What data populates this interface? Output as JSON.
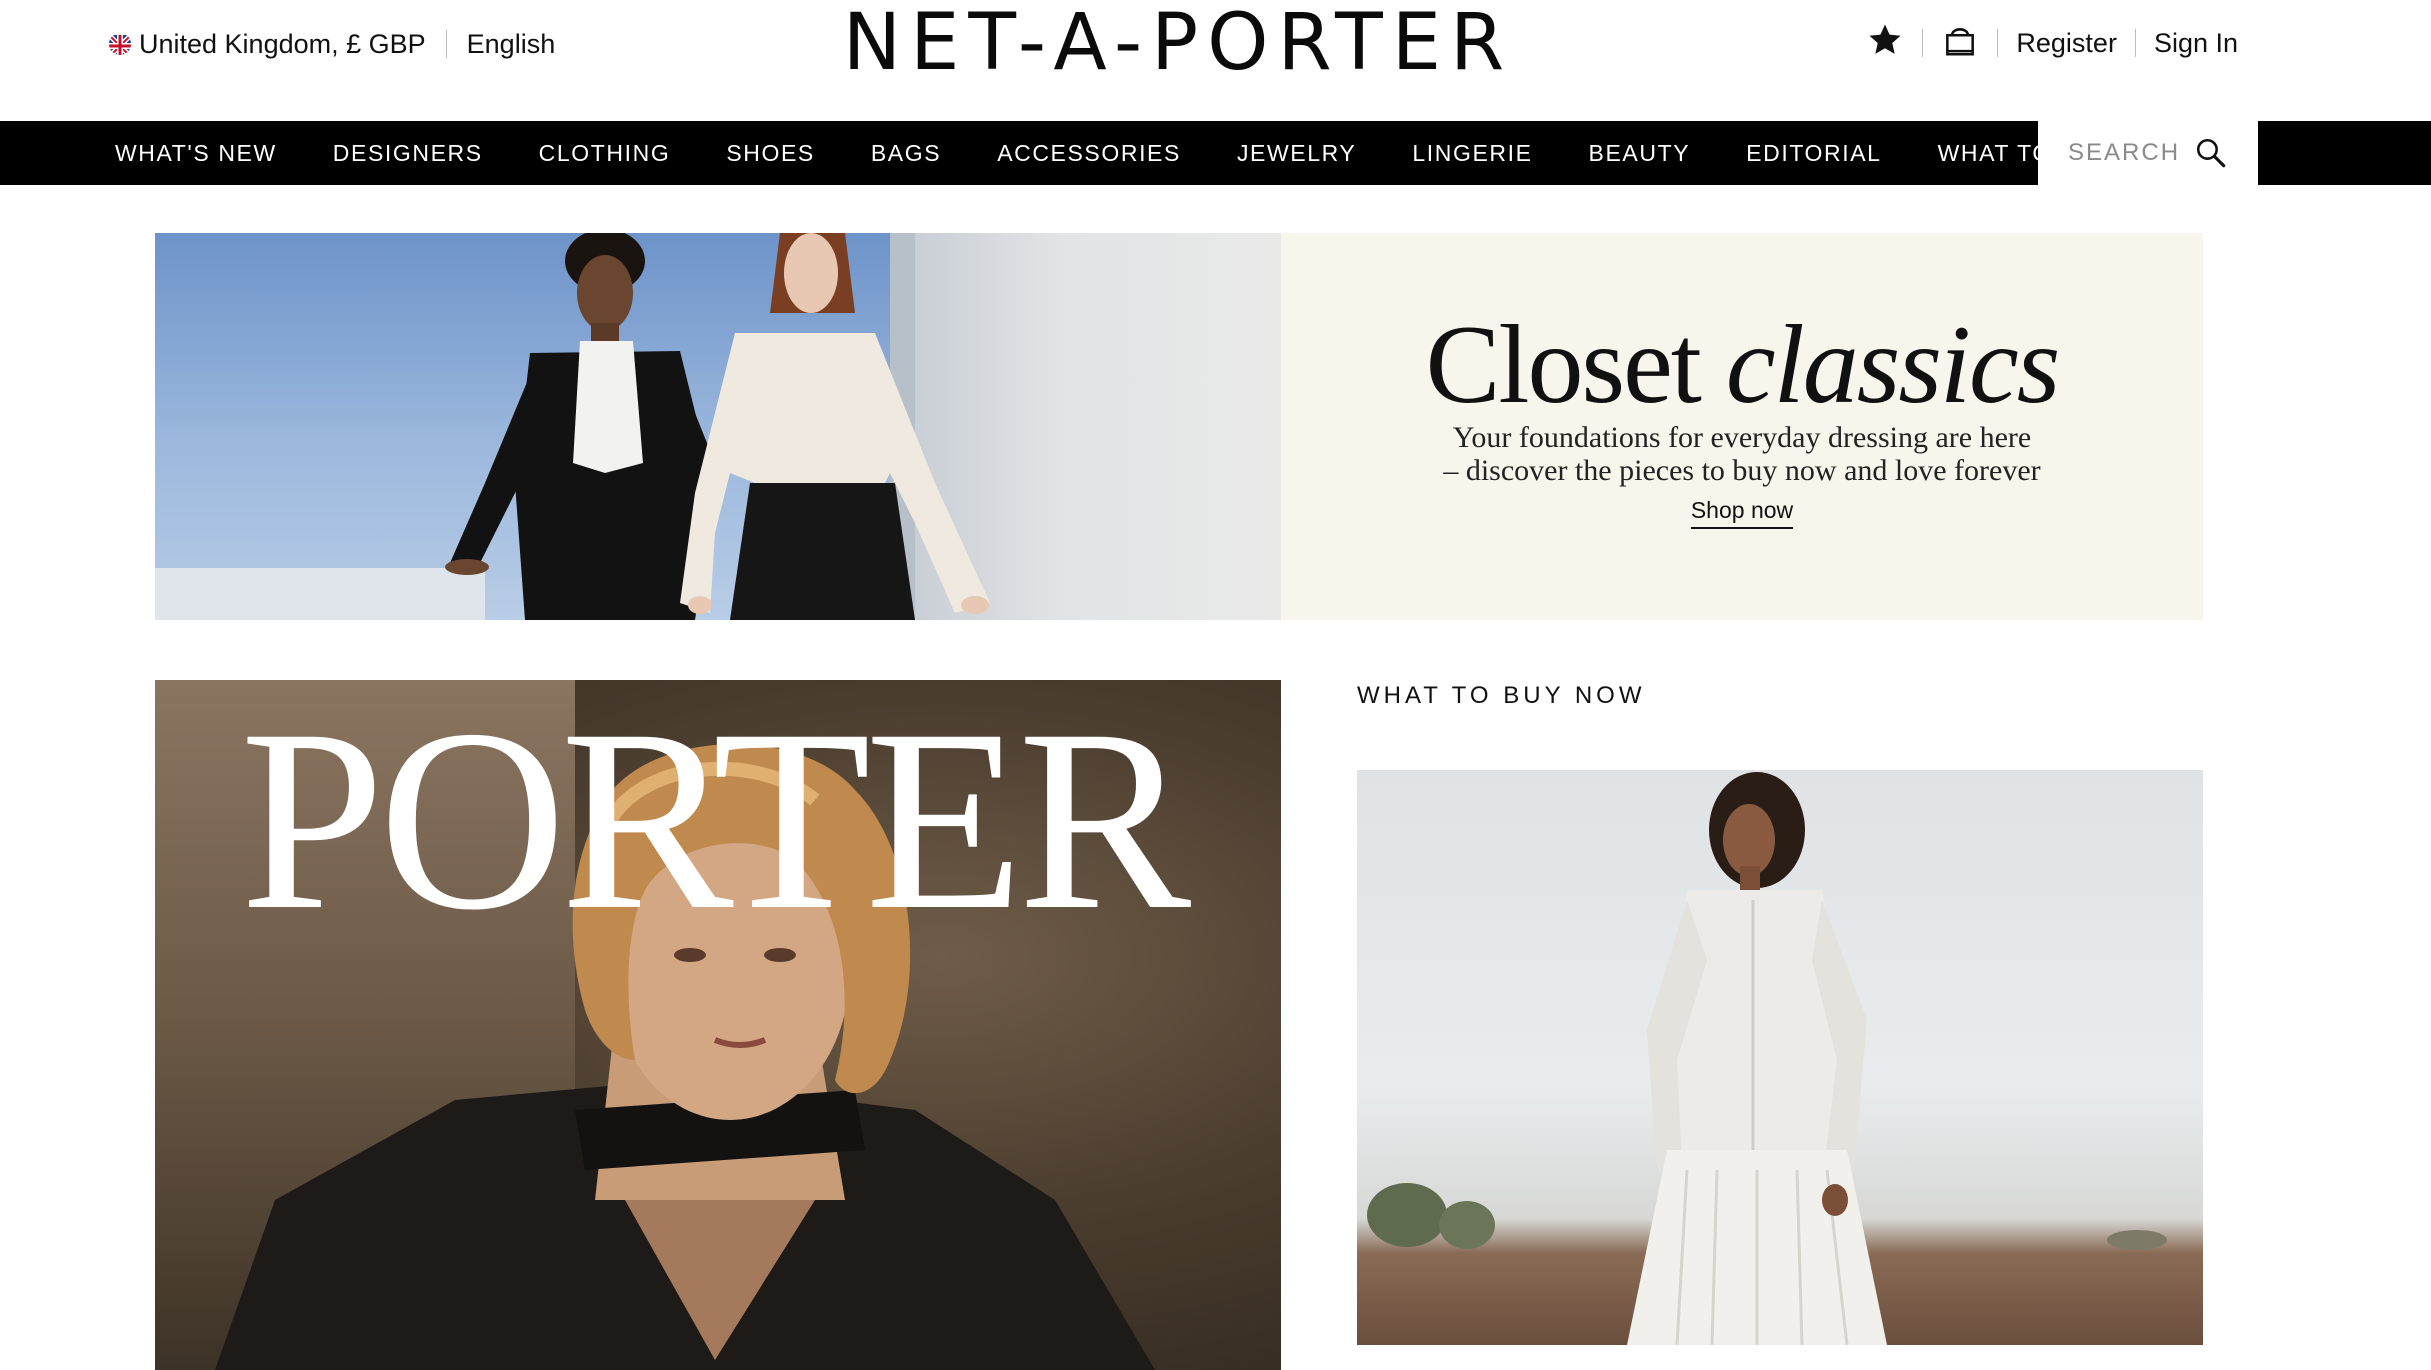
{
  "topbar": {
    "region": "United Kingdom, £ GBP",
    "language": "English",
    "logo": "NET-A-PORTER",
    "register": "Register",
    "sign_in": "Sign In"
  },
  "nav": {
    "items": [
      "WHAT'S NEW",
      "DESIGNERS",
      "CLOTHING",
      "SHOES",
      "BAGS",
      "ACCESSORIES",
      "JEWELRY",
      "LINGERIE",
      "BEAUTY",
      "EDITORIAL",
      "WHAT TO WEAR"
    ],
    "search_label": "SEARCH"
  },
  "hero": {
    "title_regular": "Closet",
    "title_italic": "classics",
    "subtitle_line1": "Your foundations for everyday dressing are here",
    "subtitle_line2": "– discover the pieces to buy now and love forever",
    "cta": "Shop now"
  },
  "feature": {
    "magazine_word": "PORTER",
    "section_title": "WHAT TO BUY NOW"
  },
  "icons": {
    "flag": "uk-flag-icon",
    "wishlist": "star-icon",
    "bag": "shopping-bag-icon",
    "search": "search-icon"
  },
  "colors": {
    "nav_bg": "#000000",
    "hero_panel_bg": "#f8f5ec",
    "text": "#111111"
  }
}
